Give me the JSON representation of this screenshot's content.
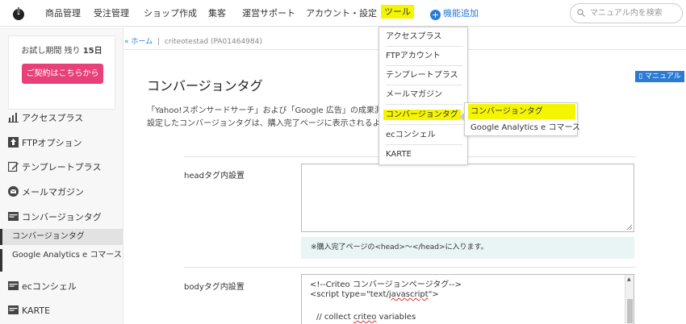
{
  "header": {
    "nav": [
      "商品管理",
      "受注管理",
      "ショップ作成",
      "集客",
      "運営サポート",
      "アカウント・設定"
    ],
    "tools": "ツール",
    "add_feature": "機能追加",
    "search_placeholder": "マニュアル内を検索"
  },
  "trial": {
    "text_prefix": "お試し期間 残り",
    "days": "15日",
    "contract_button": "ご契約はこちらから"
  },
  "sidebar": {
    "items": [
      {
        "label": "アクセスプラス",
        "icon": "chart-icon"
      },
      {
        "label": "FTPオプション",
        "icon": "upload-icon"
      },
      {
        "label": "テンプレートプラス",
        "icon": "edit-icon"
      },
      {
        "label": "メールマガジン",
        "icon": "mail-icon"
      },
      {
        "label": "コンバージョンタグ",
        "icon": "tag-icon"
      },
      {
        "label": "ecコンシェル",
        "icon": "tag-icon"
      },
      {
        "label": "KARTE",
        "icon": "tag-icon"
      }
    ],
    "sub_items": [
      "コンバージョンタグ",
      "Google Analytics e コマース"
    ]
  },
  "breadcrumb": {
    "home": "« ホーム",
    "separator": "|",
    "shop": "criteotestad",
    "shop_id": "(PA01464984)"
  },
  "main": {
    "title": "コンバージョンタグ",
    "manual_button": "マニュアル",
    "desc_line1": "「Yahoo!スポンサードサーチ」および「Google 広告」の成果測",
    "desc_line2": "設定したコンバージョンタグは、購入完了ページに表示されるよ",
    "head_label": "headタグ内設置",
    "head_hint": "※購入完了ページの<head>～</head>に入ります。",
    "body_label": "bodyタグ内設置",
    "code_lines": [
      "<!--Criteo コンバージョンページタグ-->",
      "<script type=\"text/javascript\">",
      "// collect criteo variables"
    ]
  },
  "dropdown": {
    "items": [
      "アクセスプラス",
      "FTPアカウント",
      "テンプレートプラス",
      "メールマガジン",
      "コンバージョンタグ",
      "ecコンシェル",
      "KARTE"
    ],
    "submenu": [
      "コンバージョンタグ",
      "Google Analytics e コマース"
    ]
  },
  "colors": {
    "accent": "#2a7bd5",
    "highlight": "#f5f500",
    "contract": "#e8417a"
  }
}
